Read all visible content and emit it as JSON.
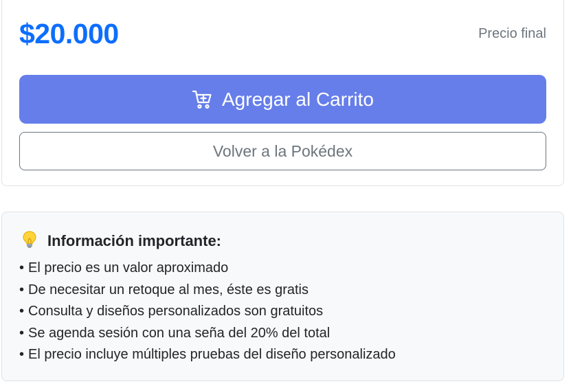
{
  "product": {
    "price": "$20.000",
    "price_note": "Precio final",
    "add_to_cart_label": "Agregar al Carrito",
    "back_label": "Volver a la Pokédex"
  },
  "info": {
    "title": "Información importante:",
    "icon": "lightbulb-icon",
    "bullet": "•",
    "items": [
      "El precio es un valor aproximado",
      "De necesitar un retoque al mes, éste es gratis",
      "Consulta y diseños personalizados son gratuitos",
      "Se agenda sesión con una seña del 20% del total",
      "El precio incluye múltiples pruebas del diseño personalizado"
    ]
  },
  "colors": {
    "accent": "#0d6efd",
    "button": "#667eea",
    "muted": "#6c757d",
    "info_bg": "#f8f9fa",
    "border": "#dee2e6"
  }
}
